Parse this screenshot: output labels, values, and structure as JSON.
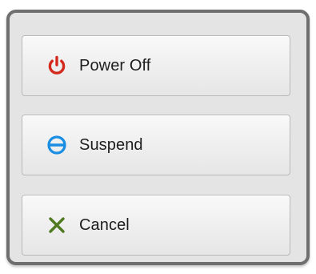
{
  "dialog": {
    "buttons": [
      {
        "label": "Power Off",
        "icon": "power-icon",
        "icon_color": "#d42a1e"
      },
      {
        "label": "Suspend",
        "icon": "suspend-icon",
        "icon_color": "#1a8ee3"
      },
      {
        "label": "Cancel",
        "icon": "close-icon",
        "icon_color": "#4f7a22"
      }
    ]
  }
}
